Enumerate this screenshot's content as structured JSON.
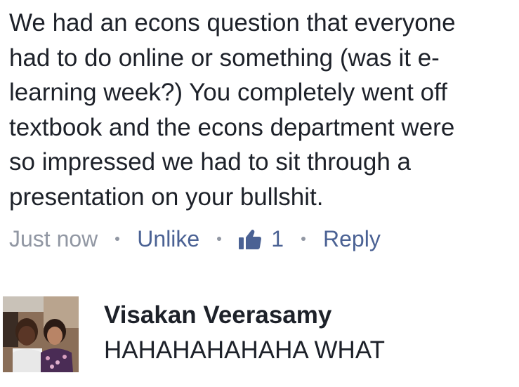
{
  "comment": {
    "lines": [
      "We had an econs question that everyone",
      "had to do online or something (was it e-",
      "learning week?) You completely went off",
      "textbook and the econs department were",
      "so impressed we had to sit through a",
      "presentation on your bullshit."
    ],
    "timestamp": "Just now",
    "unlike_label": "Unlike",
    "like_count": "1",
    "reply_label": "Reply",
    "like_icon": "thumbs-up-icon"
  },
  "reply": {
    "author": "Visakan Veerasamy",
    "text": "HAHAHAHAHAHA WHAT",
    "avatar_icon": "profile-photo"
  },
  "colors": {
    "text": "#1d2129",
    "meta": "#9197a3",
    "link": "#4b6294"
  }
}
